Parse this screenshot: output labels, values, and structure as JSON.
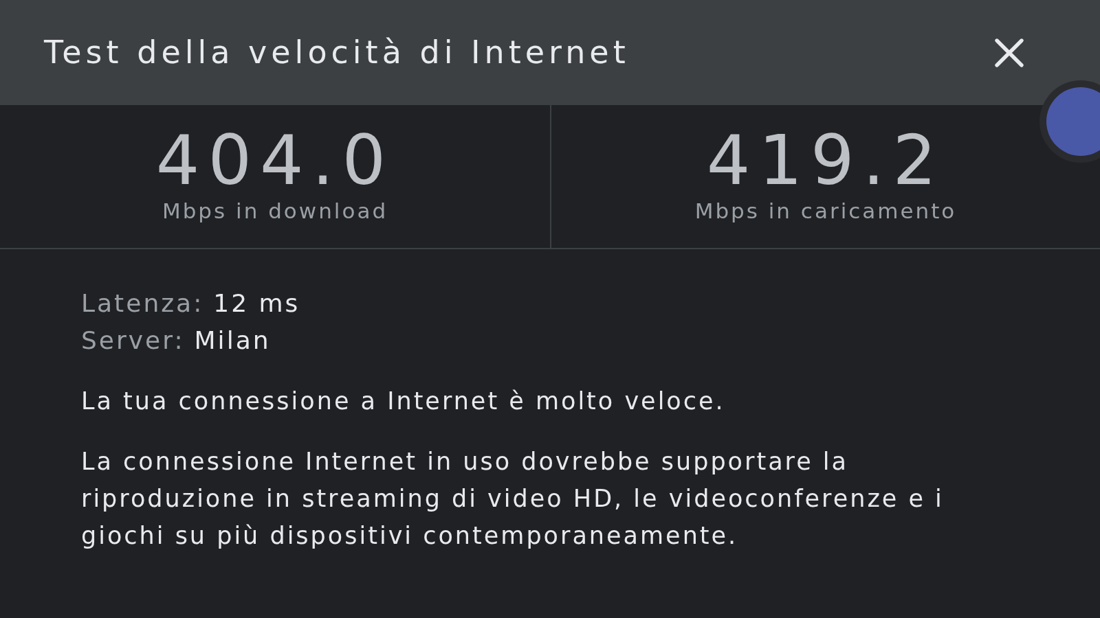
{
  "header": {
    "title": "Test della velocità di Internet"
  },
  "results": [
    {
      "value": "404.0",
      "label": "Mbps in download"
    },
    {
      "value": "419.2",
      "label": "Mbps in caricamento"
    }
  ],
  "details": [
    {
      "label": "Latenza:",
      "value": "12 ms"
    },
    {
      "label": "Server:",
      "value": "Milan"
    }
  ],
  "summary": "La tua connessione a Internet è molto veloce.",
  "description": "La connessione Internet in uso dovrebbe supportare la riproduzione in streaming di video HD, le videoconferenze e i giochi su più dispositivi contemporaneamente."
}
